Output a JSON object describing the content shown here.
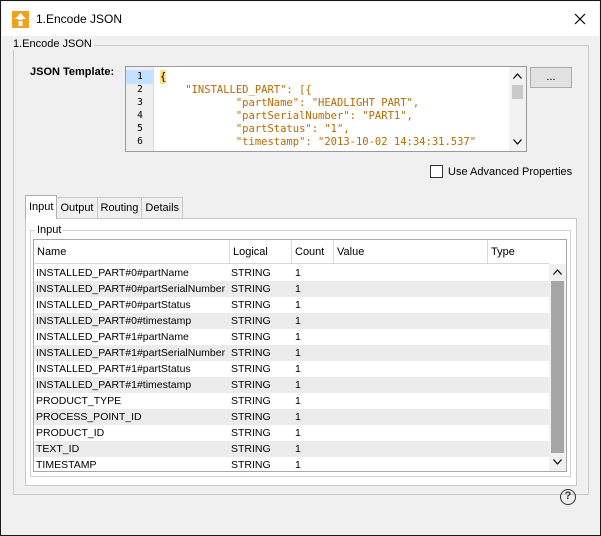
{
  "window": {
    "title": "1.Encode JSON",
    "accent": "#f0a11f"
  },
  "group": {
    "label": "1.Encode JSON"
  },
  "template": {
    "label": "JSON Template:",
    "browse_label": "...",
    "line_numbers": [
      "1",
      "2",
      "3",
      "4",
      "5",
      "6"
    ],
    "lines": [
      "{",
      "    \"INSTALLED_PART\": [{",
      "            \"partName\": \"HEADLIGHT PART\",",
      "            \"partSerialNumber\": \"PART1\",",
      "            \"partStatus\": \"1\",",
      "            \"timestamp\": \"2013-10-02 14:34:31.537\""
    ]
  },
  "advanced": {
    "label": "Use Advanced Properties",
    "checked": false
  },
  "tabs": [
    {
      "label": "Input",
      "active": true
    },
    {
      "label": "Output",
      "active": false
    },
    {
      "label": "Routing",
      "active": false
    },
    {
      "label": "Details",
      "active": false
    }
  ],
  "input_panel": {
    "label": "Input",
    "columns": [
      "Name",
      "Logical",
      "Count",
      "Value",
      "Type"
    ],
    "rows": [
      [
        "INSTALLED_PART#0#partName",
        "STRING",
        "1",
        "",
        ""
      ],
      [
        "INSTALLED_PART#0#partSerialNumber",
        "STRING",
        "1",
        "",
        ""
      ],
      [
        "INSTALLED_PART#0#partStatus",
        "STRING",
        "1",
        "",
        ""
      ],
      [
        "INSTALLED_PART#0#timestamp",
        "STRING",
        "1",
        "",
        ""
      ],
      [
        "INSTALLED_PART#1#partName",
        "STRING",
        "1",
        "",
        ""
      ],
      [
        "INSTALLED_PART#1#partSerialNumber",
        "STRING",
        "1",
        "",
        ""
      ],
      [
        "INSTALLED_PART#1#partStatus",
        "STRING",
        "1",
        "",
        ""
      ],
      [
        "INSTALLED_PART#1#timestamp",
        "STRING",
        "1",
        "",
        ""
      ],
      [
        "PRODUCT_TYPE",
        "STRING",
        "1",
        "",
        ""
      ],
      [
        "PROCESS_POINT_ID",
        "STRING",
        "1",
        "",
        ""
      ],
      [
        "PRODUCT_ID",
        "STRING",
        "1",
        "",
        ""
      ],
      [
        "TEXT_ID",
        "STRING",
        "1",
        "",
        ""
      ],
      [
        "TIMESTAMP",
        "STRING",
        "1",
        "",
        ""
      ]
    ]
  },
  "help": {
    "label": "?"
  },
  "close": {
    "label": "✕"
  }
}
